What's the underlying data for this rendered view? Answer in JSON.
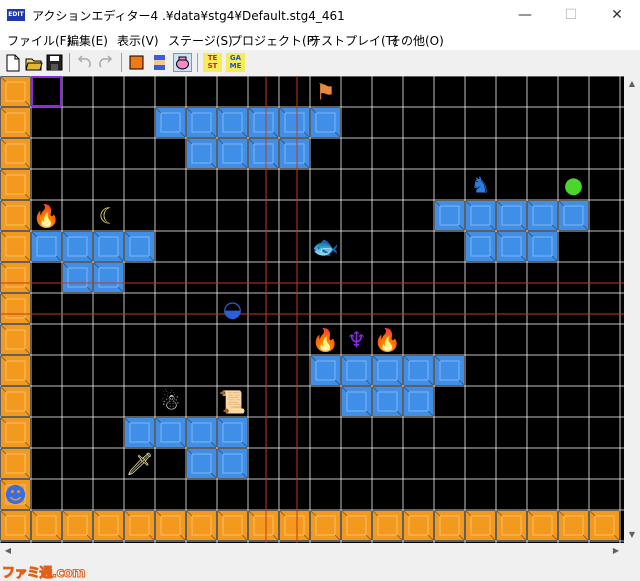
{
  "window": {
    "app_icon_text": "EDIT",
    "title": "アクションエディター4  .¥data¥stg4¥Default.stg4_461",
    "minimize": "—",
    "maximize": "☐",
    "close": "✕"
  },
  "menu": [
    "ファイル(F)",
    "編集(E)",
    "表示(V)",
    "ステージ(S)",
    "プロジェクト(P)",
    "テストプレイ(T)",
    "その他(O)"
  ],
  "toolbar": {
    "buttons": [
      "new-file",
      "open-folder",
      "save-disk",
      "undo",
      "redo",
      "block-tool",
      "character-tool",
      "item-pot-tool",
      "test-play",
      "game"
    ],
    "test_label": "TE ST",
    "game_label": "GA ME"
  },
  "grid": {
    "columns": 20,
    "rows": 15,
    "cell_color": "#000000",
    "line_color": "#ffffff",
    "ground_color": "#f39a1e",
    "block_color": "#3f8fe8",
    "guide_color": "#c0391b",
    "cursor_color": "#8a2be2",
    "left_wall": [
      0,
      1,
      2,
      3,
      4,
      5,
      6,
      7,
      8,
      9,
      10,
      11,
      12,
      13,
      14
    ],
    "floor_row": 14,
    "blue_blocks": [
      [
        1,
        5
      ],
      [
        1,
        6
      ],
      [
        1,
        7
      ],
      [
        1,
        8
      ],
      [
        1,
        9
      ],
      [
        1,
        10
      ],
      [
        2,
        6
      ],
      [
        2,
        7
      ],
      [
        2,
        8
      ],
      [
        2,
        9
      ],
      [
        4,
        14
      ],
      [
        4,
        15
      ],
      [
        4,
        16
      ],
      [
        4,
        17
      ],
      [
        4,
        18
      ],
      [
        5,
        1
      ],
      [
        5,
        2
      ],
      [
        5,
        3
      ],
      [
        5,
        4
      ],
      [
        5,
        15
      ],
      [
        5,
        16
      ],
      [
        5,
        17
      ],
      [
        6,
        2
      ],
      [
        6,
        3
      ],
      [
        9,
        10
      ],
      [
        9,
        11
      ],
      [
        9,
        12
      ],
      [
        9,
        13
      ],
      [
        9,
        14
      ],
      [
        10,
        11
      ],
      [
        10,
        12
      ],
      [
        10,
        13
      ],
      [
        11,
        4
      ],
      [
        11,
        5
      ],
      [
        11,
        6
      ],
      [
        11,
        7
      ],
      [
        12,
        6
      ],
      [
        12,
        7
      ]
    ],
    "vertical_guides": [
      9,
      10
    ],
    "horizontal_guides": [
      7,
      8
    ],
    "cursor": [
      0,
      1
    ]
  },
  "sprites": [
    {
      "name": "green-flame-enemy",
      "row": 4,
      "col": 1,
      "glyph": "🔥",
      "color": "#7fdc2a"
    },
    {
      "name": "moon-face-enemy",
      "row": 4,
      "col": 3,
      "glyph": "☾",
      "color": "#f5e16a"
    },
    {
      "name": "grey-fish-enemy",
      "row": 5,
      "col": 10,
      "glyph": "🐟",
      "color": "#cfcfcf"
    },
    {
      "name": "blue-dragon-enemy",
      "row": 3,
      "col": 15,
      "glyph": "♞",
      "color": "#2d7de0"
    },
    {
      "name": "green-orb-item",
      "row": 3,
      "col": 18,
      "glyph": "●",
      "color": "#4bd62a"
    },
    {
      "name": "blue-whale-enemy",
      "row": 7,
      "col": 7,
      "glyph": "◒",
      "color": "#2a5fd6"
    },
    {
      "name": "red-flame-enemy-left",
      "row": 8,
      "col": 10,
      "glyph": "🔥",
      "color": "#ff4a1a"
    },
    {
      "name": "purple-squid-enemy",
      "row": 8,
      "col": 11,
      "glyph": "♆",
      "color": "#8a2be2"
    },
    {
      "name": "red-flame-enemy-right",
      "row": 8,
      "col": 12,
      "glyph": "🔥",
      "color": "#ff4a1a"
    },
    {
      "name": "grey-robot-enemy",
      "row": 10,
      "col": 5,
      "glyph": "☃",
      "color": "#d8d8d8"
    },
    {
      "name": "scroll-item",
      "row": 10,
      "col": 7,
      "glyph": "📜",
      "color": "#e8e0c0"
    },
    {
      "name": "sword-item",
      "row": 12,
      "col": 4,
      "glyph": "🗡",
      "color": "#f0e8a0"
    },
    {
      "name": "player-character",
      "row": 13,
      "col": 0,
      "glyph": "☻",
      "color": "#3a6ee0"
    },
    {
      "name": "goal-flag-marker",
      "row": 0,
      "col": 10,
      "glyph": "⚑",
      "color": "#e88a3a"
    }
  ],
  "scroll": {
    "up": "▲",
    "down": "▼",
    "left": "◀",
    "right": "▶"
  },
  "watermark": "ファミ通.com"
}
